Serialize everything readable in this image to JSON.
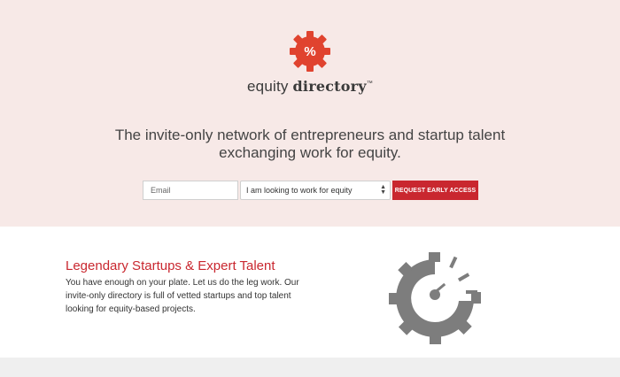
{
  "brand": {
    "name_light": "equity",
    "name_bold": "directory",
    "trademark": "™",
    "logo_symbol": "%",
    "accent_color": "#c9272f"
  },
  "hero": {
    "tagline_line1": "The invite-only network of entrepreneurs and startup talent",
    "tagline_line2": "exchanging work for equity."
  },
  "signup": {
    "email_placeholder": "Email",
    "role_select_value": "I am looking to work for equity",
    "cta_label": "REQUEST EARLY ACCESS"
  },
  "feature": {
    "title": "Legendary Startups & Expert Talent",
    "body": "You have enough on your plate. Let us do the leg work. Our invite-only directory is full of vetted startups and top talent looking for equity-based projects.",
    "icon": "gear-gauge-icon"
  }
}
